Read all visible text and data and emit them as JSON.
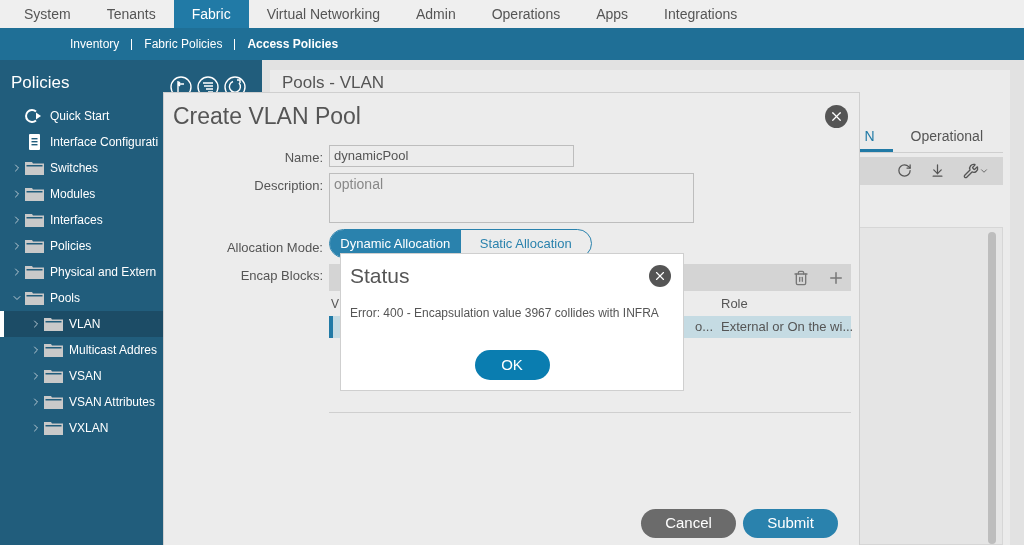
{
  "top_nav": {
    "tabs": [
      {
        "label": "System",
        "selected": false
      },
      {
        "label": "Tenants",
        "selected": false
      },
      {
        "label": "Fabric",
        "selected": true
      },
      {
        "label": "Virtual Networking",
        "selected": false
      },
      {
        "label": "Admin",
        "selected": false
      },
      {
        "label": "Operations",
        "selected": false
      },
      {
        "label": "Apps",
        "selected": false
      },
      {
        "label": "Integrations",
        "selected": false
      }
    ]
  },
  "sub_nav": {
    "items": [
      {
        "label": "Inventory",
        "selected": false
      },
      {
        "label": "Fabric Policies",
        "selected": false
      },
      {
        "label": "Access Policies",
        "selected": true
      }
    ]
  },
  "sidebar": {
    "title": "Policies",
    "items": [
      {
        "label": "Quick Start",
        "kind": "action",
        "selected": false
      },
      {
        "label": "Interface Configurati",
        "kind": "document",
        "selected": false
      },
      {
        "label": "Switches",
        "kind": "folder",
        "expanded": false,
        "selected": false
      },
      {
        "label": "Modules",
        "kind": "folder",
        "expanded": false,
        "selected": false
      },
      {
        "label": "Interfaces",
        "kind": "folder",
        "expanded": false,
        "selected": false
      },
      {
        "label": "Policies",
        "kind": "folder",
        "expanded": false,
        "selected": false
      },
      {
        "label": "Physical and Extern",
        "kind": "folder",
        "expanded": false,
        "selected": false
      },
      {
        "label": "Pools",
        "kind": "folder",
        "expanded": true,
        "selected": false,
        "children": [
          {
            "label": "VLAN",
            "kind": "folder",
            "expanded": false,
            "selected": true
          },
          {
            "label": "Multicast Addres",
            "kind": "folder",
            "expanded": false,
            "selected": false
          },
          {
            "label": "VSAN",
            "kind": "folder",
            "expanded": false,
            "selected": false
          },
          {
            "label": "VSAN Attributes",
            "kind": "folder",
            "expanded": false,
            "selected": false
          },
          {
            "label": "VXLAN",
            "kind": "folder",
            "expanded": false,
            "selected": false
          }
        ]
      }
    ]
  },
  "main_panel": {
    "title": "Pools - VLAN",
    "tabs": [
      {
        "label": "N",
        "selected": true
      },
      {
        "label": "Operational",
        "selected": false
      }
    ]
  },
  "create_dialog": {
    "title": "Create VLAN Pool",
    "fields": [
      {
        "label": "Name:",
        "kind": "input",
        "value": "dynamicPool"
      },
      {
        "label": "Description:",
        "kind": "textarea",
        "placeholder": "optional"
      }
    ],
    "allocation_mode": {
      "label": "Allocation Mode:",
      "options": [
        {
          "label": "Dynamic Allocation",
          "selected": true
        },
        {
          "label": "Static Allocation",
          "selected": false
        }
      ]
    },
    "encap_blocks": {
      "label": "Encap Blocks:",
      "columns": [
        "V",
        "Role"
      ],
      "rows": [
        {
          "selected": true,
          "cells": [
            "o...",
            "External or On the wi..."
          ]
        }
      ]
    },
    "buttons": [
      {
        "label": "Cancel",
        "kind": "secondary"
      },
      {
        "label": "Submit",
        "kind": "primary"
      }
    ]
  },
  "status_dialog": {
    "title": "Status",
    "message": "Error: 400 - Encapsulation value 3967 collides with INFRA",
    "buttons": [
      "OK"
    ]
  }
}
